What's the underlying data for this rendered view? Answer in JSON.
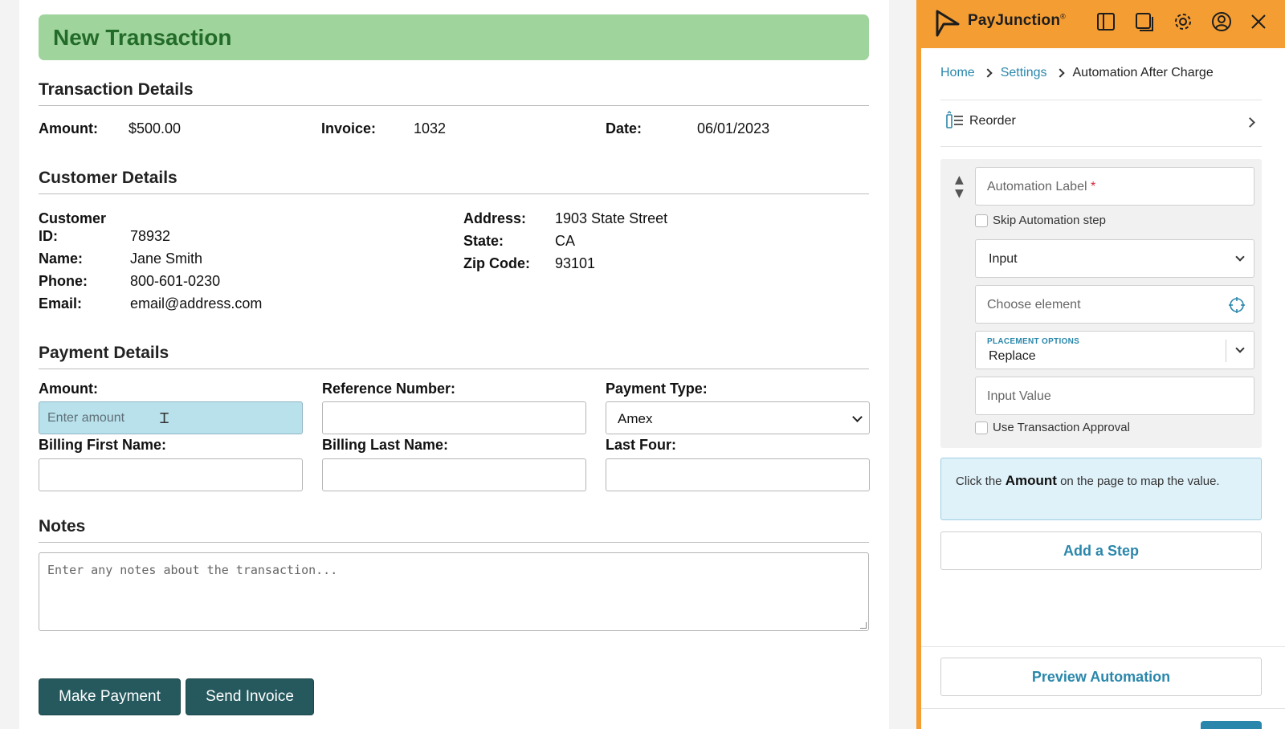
{
  "form": {
    "banner_title": "New Transaction",
    "transaction_section": "Transaction Details",
    "transaction": {
      "amount_label": "Amount:",
      "amount_value": "$500.00",
      "invoice_label": "Invoice:",
      "invoice_value": "1032",
      "date_label": "Date:",
      "date_value": "06/01/2023"
    },
    "customer_section": "Customer Details",
    "customer": {
      "id_label_1": "Customer",
      "id_label_2": "ID:",
      "id_value": "78932",
      "name_label": "Name:",
      "name_value": "Jane Smith",
      "phone_label": "Phone:",
      "phone_value": "800-601-0230",
      "email_label": "Email:",
      "email_value": "email@address.com",
      "address_label": "Address:",
      "address_value": "1903 State Street",
      "state_label": "State:",
      "state_value": "CA",
      "zip_label": "Zip Code:",
      "zip_value": "93101"
    },
    "payment_section": "Payment Details",
    "payment": {
      "amount_label": "Amount:",
      "amount_placeholder": "Enter amount",
      "reference_label": "Reference Number:",
      "type_label": "Payment Type:",
      "type_value": "Amex",
      "first_name_label": "Billing First Name:",
      "last_name_label": "Billing Last Name:",
      "last_four_label": "Last Four:"
    },
    "notes_section": "Notes",
    "notes_placeholder": "Enter any notes about the transaction...",
    "make_payment": "Make Payment",
    "send_invoice": "Send Invoice"
  },
  "panel": {
    "brand": "PayJunction",
    "brand_mark": "®",
    "breadcrumb": {
      "home": "Home",
      "settings": "Settings",
      "current": "Automation After Charge"
    },
    "reorder": "Reorder",
    "step": {
      "label_placeholder": "Automation Label",
      "required_mark": "*",
      "skip_label": "Skip Automation step",
      "action_value": "Input",
      "element_placeholder": "Choose element",
      "placement_label": "PLACEMENT OPTIONS",
      "placement_value": "Replace",
      "input_value_placeholder": "Input Value",
      "approval_label": "Use Transaction Approval"
    },
    "hint": {
      "prefix": "Click the",
      "target": "Amount",
      "suffix": "on the page to map the value."
    },
    "add_step": "Add a Step",
    "preview": "Preview Automation"
  },
  "colors": {
    "accent_orange": "#f49d33",
    "link_blue": "#2a87ab",
    "banner_green": "#9fd49c",
    "button_teal": "#25595e"
  }
}
